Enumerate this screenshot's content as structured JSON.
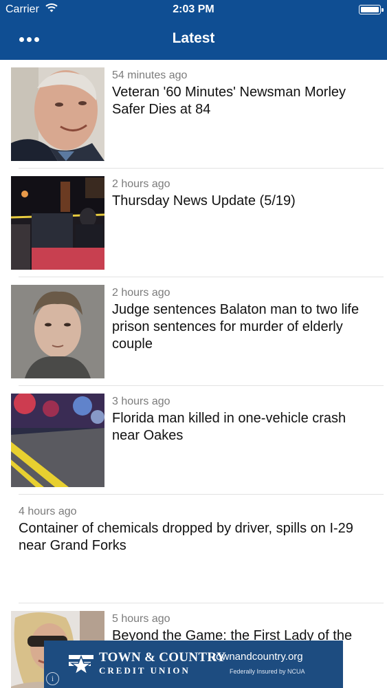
{
  "status_bar": {
    "carrier": "Carrier",
    "time": "2:03 PM",
    "wifi_icon": "wifi-icon",
    "battery_icon": "battery-full-icon",
    "battery_level": 1.0
  },
  "nav": {
    "title": "Latest",
    "menu_icon": "more-dots-icon"
  },
  "colors": {
    "header_bg": "#0f4e93",
    "timestamp": "#7b7b7b",
    "ad_bg": "#1d4c80"
  },
  "feed": {
    "items": [
      {
        "time": "54 minutes ago",
        "headline": "Veteran '60 Minutes' Newsman Morley Safer Dies at 84",
        "has_image": true
      },
      {
        "time": "2 hours ago",
        "headline": "Thursday News Update (5/19)",
        "has_image": true
      },
      {
        "time": "2 hours ago",
        "headline": "Judge sentences Balaton man to two life prison sentences for murder of elderly couple",
        "has_image": true
      },
      {
        "time": "3 hours ago",
        "headline": "Florida man killed in one-vehicle crash near Oakes",
        "has_image": true
      },
      {
        "time": "4 hours ago",
        "headline": "Container of chemicals dropped by driver, spills on I-29 near Grand Forks",
        "has_image": false
      },
      {
        "time": "5 hours ago",
        "headline": "Beyond the Game: the First Lady of the Fargo Marathon",
        "has_image": true
      }
    ]
  },
  "ad": {
    "name_line1": "TOWN & COUNTRY",
    "name_line2": "CREDIT UNION",
    "url": "townandcountry.org",
    "insured": "Federally Insured by NCUA",
    "info_icon": "info-icon"
  }
}
